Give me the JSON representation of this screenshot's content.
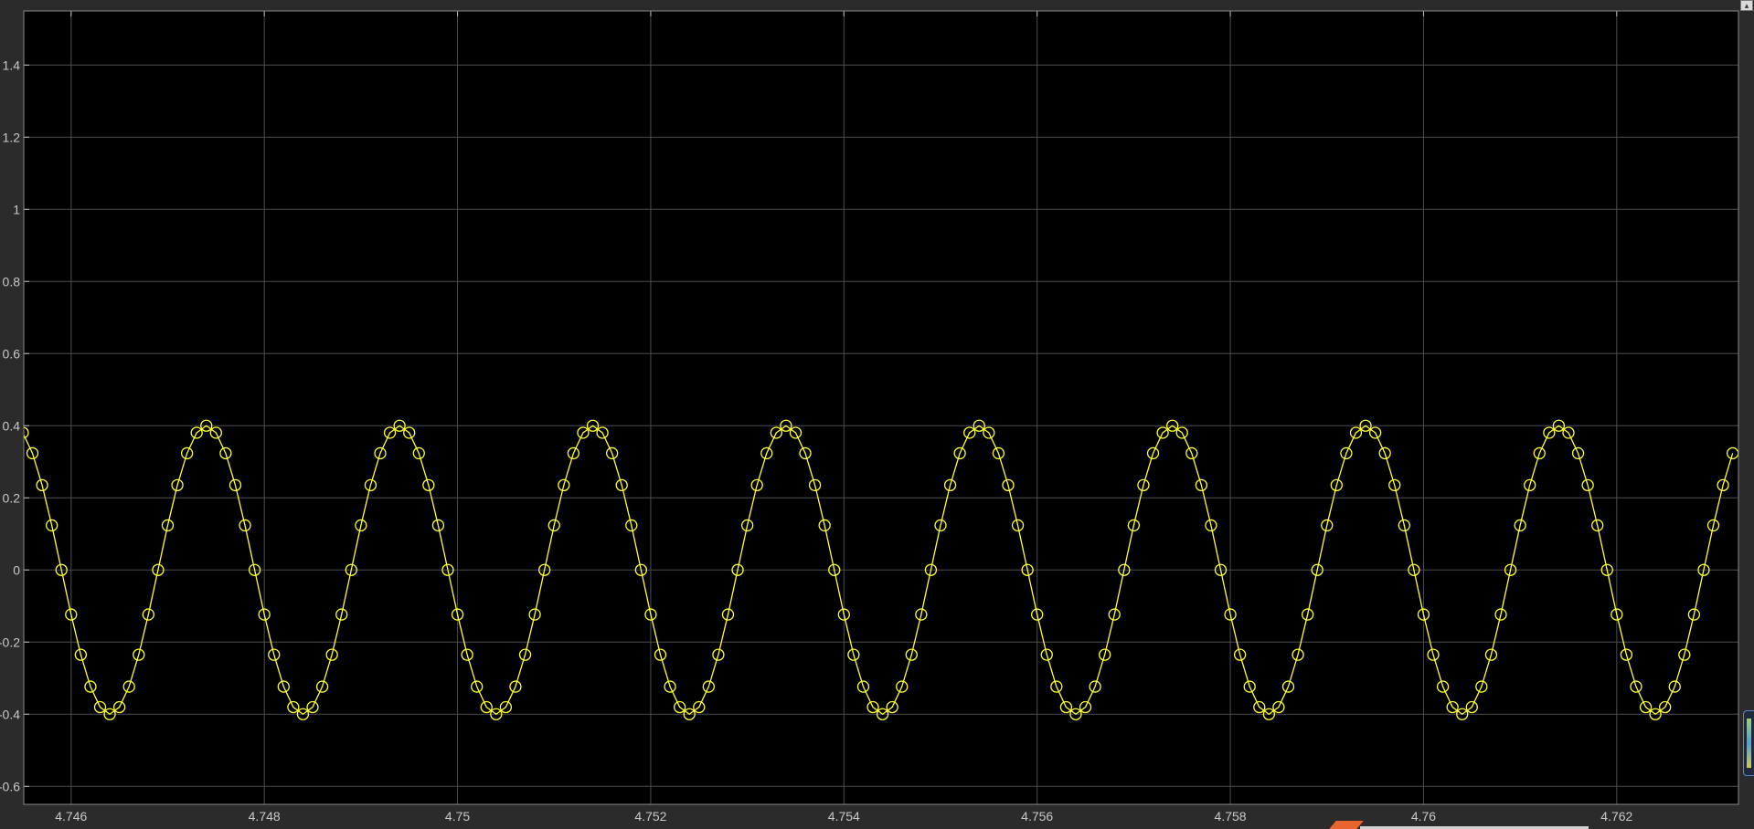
{
  "icons": {
    "corner_button": "expand-icon",
    "side_handle": "legend-handle-icon",
    "bottom_marker": "data-cursor-marker-icon"
  },
  "colors": {
    "background": "#000000",
    "grid": "#4d4d4d",
    "signal": "#ffff33",
    "ticks": "#c8c8c8"
  },
  "chart_data": {
    "type": "line",
    "title": "",
    "xlabel": "",
    "ylabel": "",
    "xlim": [
      4.74551,
      4.76326
    ],
    "ylim": [
      -0.65,
      1.55
    ],
    "x_ticks": [
      4.746,
      4.748,
      4.75,
      4.752,
      4.754,
      4.756,
      4.758,
      4.76,
      4.762
    ],
    "x_tick_labels": [
      "4.746",
      "4.748",
      "4.75",
      "4.752",
      "4.754",
      "4.756",
      "4.758",
      "4.76",
      "4.762"
    ],
    "y_ticks": [
      -0.6,
      -0.4,
      -0.2,
      0,
      0.2,
      0.4,
      0.6,
      0.8,
      1,
      1.2,
      1.4
    ],
    "y_tick_labels": [
      "-0.6",
      "-0.4",
      "-0.2",
      "0",
      "0.2",
      "0.4",
      "0.6",
      "0.8",
      "1",
      "1.2",
      "1.4"
    ],
    "grid": true,
    "marker": "circle",
    "series": [
      {
        "color": "#ffff33",
        "amplitude": 0.4,
        "frequency_hz": 500,
        "peak_times": [
          4.7474,
          4.7494,
          4.7514,
          4.7534,
          4.7554,
          4.7574,
          4.7594,
          4.7614
        ],
        "sample_interval": 0.0001,
        "x_start": 4.7455,
        "x_end": 4.7632
      }
    ]
  }
}
